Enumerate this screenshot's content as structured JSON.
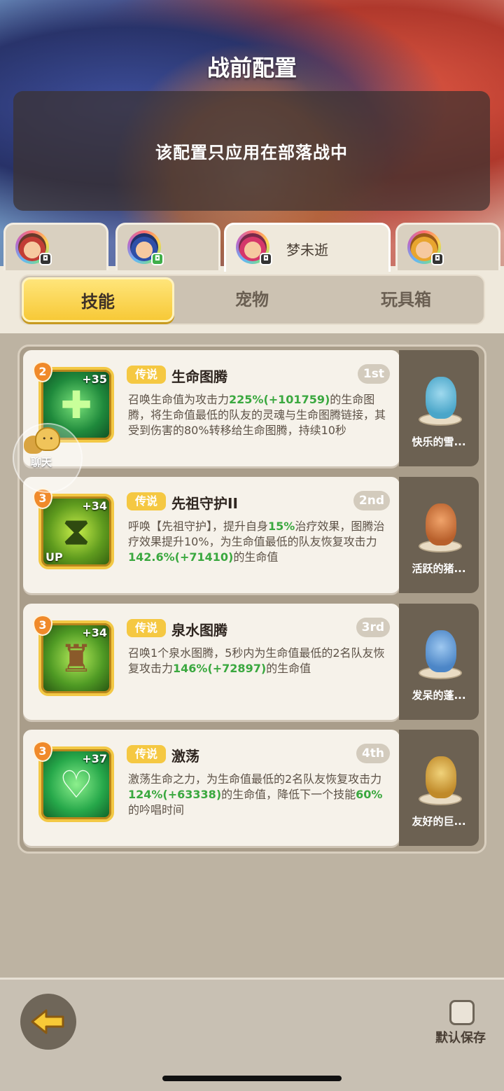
{
  "header": {
    "title": "战前配置",
    "notice": "该配置只应用在部落战中"
  },
  "players": [
    {
      "name": "",
      "active": false
    },
    {
      "name": "",
      "active": false
    },
    {
      "name": "梦未逝",
      "active": true
    },
    {
      "name": "",
      "active": false
    }
  ],
  "tabs": [
    "技能",
    "宠物",
    "玩具箱"
  ],
  "active_tab": "技能",
  "skills": [
    {
      "level": "2",
      "bonus": "+35",
      "rarity": "传说",
      "name": "生命图腾",
      "rank": "1st",
      "desc_parts": [
        "召唤生命值为攻击力",
        "225%(+101759)",
        "的生命图腾，将生命值最低的队友的灵魂与生命图腾链接，其受到伤害的80%转移给生命图腾，持续10秒"
      ],
      "pet_name": "快乐的雪..."
    },
    {
      "level": "3",
      "bonus": "+34",
      "up_label": "UP",
      "rarity": "传说",
      "name": "先祖守护II",
      "rank": "2nd",
      "desc_parts": [
        "呼唤【先祖守护】，提升自身",
        "15%",
        "治疗效果，图腾治疗效果提升10%，为生命值最低的队友恢复攻击力",
        "142.6%(+71410)",
        "的生命值"
      ],
      "pet_name": "活跃的猪..."
    },
    {
      "level": "3",
      "bonus": "+34",
      "rarity": "传说",
      "name": "泉水图腾",
      "rank": "3rd",
      "desc_parts": [
        "召唤1个泉水图腾，5秒内为生命值最低的2名队友恢复攻击力",
        "146%(+72897)",
        "的生命值"
      ],
      "pet_name": "发呆的蓬..."
    },
    {
      "level": "3",
      "bonus": "+37",
      "rarity": "传说",
      "name": "激荡",
      "rank": "4th",
      "desc_parts": [
        "激荡生命之力，为生命值最低的2名队友恢复攻击力",
        "124%(+63338)",
        "的生命值，降低下一个技能",
        "60%",
        "的吟唱时间"
      ],
      "pet_name": "友好的巨..."
    }
  ],
  "chat": {
    "label": "聊天"
  },
  "footer": {
    "save_label": "默认保存"
  },
  "colors": {
    "accent": "#f7c937",
    "highlight": "#3aa83f"
  }
}
